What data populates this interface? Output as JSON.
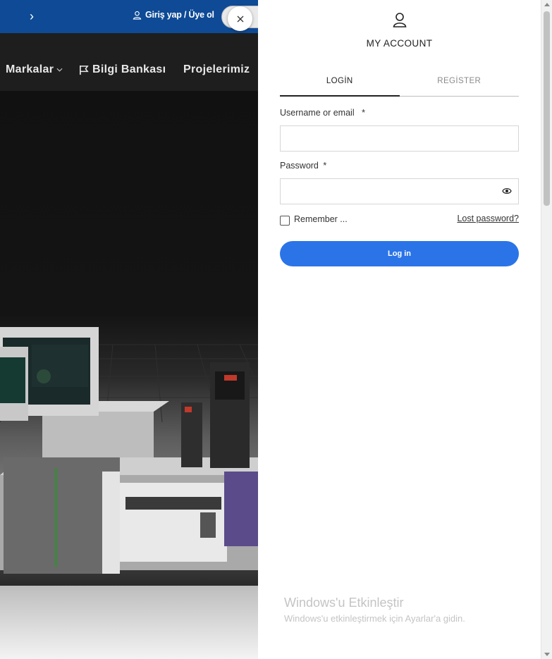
{
  "site": {
    "topbar": {
      "auth_link": "Giriş yap / Üye ol"
    },
    "nav": {
      "items": [
        "Markalar",
        "Bilgi Bankası",
        "Projelerimiz"
      ]
    }
  },
  "account_panel": {
    "title": "MY ACCOUNT",
    "tabs": [
      "LOGİN",
      "REGİSTER"
    ],
    "active_tab": "LOGİN",
    "username_label": "Username or email",
    "username_value": "",
    "password_label": "Password",
    "password_value": "",
    "required_marker": "*",
    "remember_label": "Remember ...",
    "remember_checked": false,
    "lost_password": "Lost password?",
    "login_button": "Log in"
  },
  "windows_watermark": {
    "title": "Windows'u Etkinleştir",
    "subtitle": "Windows'u etkinleştirmek için Ayarlar'a gidin."
  },
  "colors": {
    "topbar": "#0e4a96",
    "login_button": "#2b74e8",
    "navbar": "#1e1e1e"
  }
}
